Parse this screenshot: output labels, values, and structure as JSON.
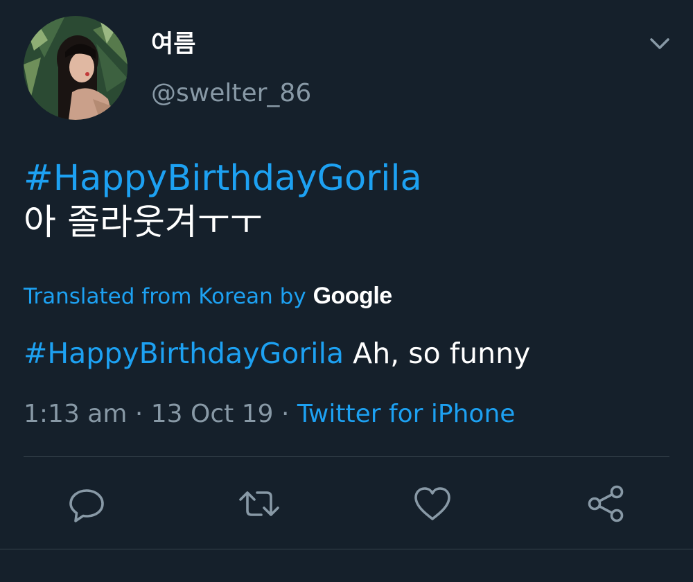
{
  "author": {
    "display_name": "여름",
    "handle": "@swelter_86"
  },
  "tweet": {
    "hashtag": "#HappyBirthdayGorila",
    "text_korean": "아 졸라웃겨ㅜㅜ"
  },
  "translation": {
    "label": "Translated from Korean by",
    "provider": "Google",
    "hashtag": "#HappyBirthdayGorila",
    "text": "Ah, so funny"
  },
  "meta": {
    "time": "1:13 am",
    "separator1": " · ",
    "date": "13 Oct 19",
    "separator2": " · ",
    "source": "Twitter for iPhone"
  },
  "actions": {
    "reply_icon": "reply-icon",
    "retweet_icon": "retweet-icon",
    "like_icon": "heart-icon",
    "share_icon": "share-icon"
  },
  "colors": {
    "background": "#15202b",
    "link": "#1da1f2",
    "secondary_text": "#8899a6",
    "divider": "#38444d"
  }
}
